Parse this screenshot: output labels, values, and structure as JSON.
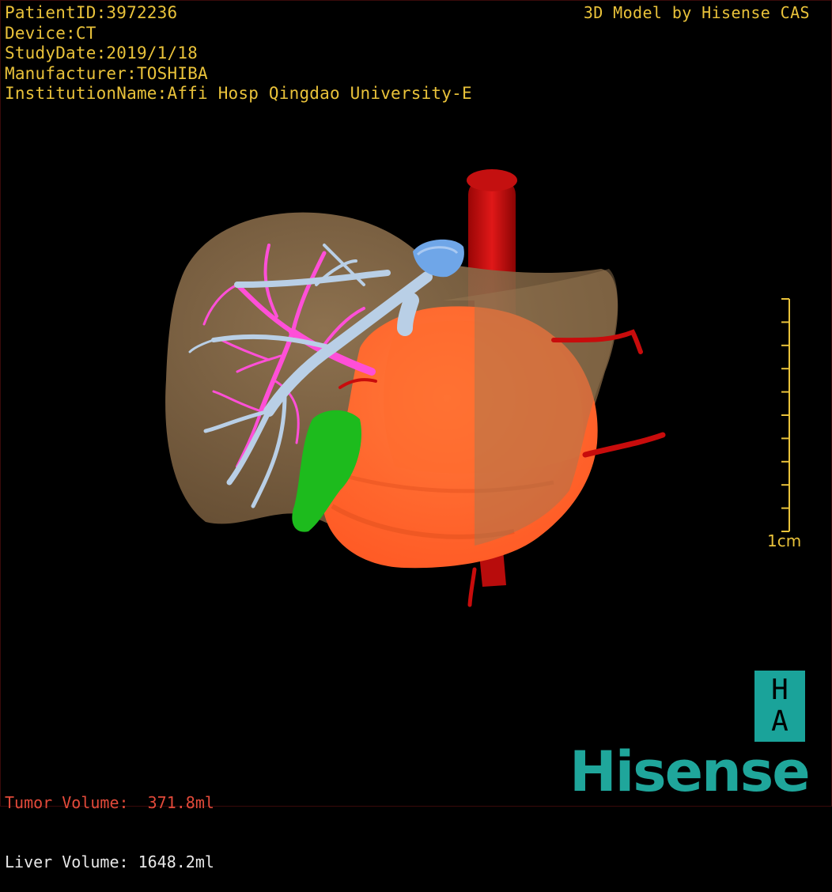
{
  "patient_info": {
    "patient_id": "PatientID:3972236",
    "device": "Device:CT",
    "study_date": "StudyDate:2019/1/18",
    "manufacturer": "Manufacturer:TOSHIBA",
    "institution": "InstitutionName:Affi Hosp Qingdao University-E"
  },
  "header": {
    "brand_text": "3D Model by Hisense CAS"
  },
  "scale_bar": {
    "label": "1cm",
    "tick_count": 11
  },
  "volumes": {
    "tumor": "Tumor Volume:  371.8ml",
    "liver": "Liver Volume: 1648.2ml"
  },
  "logo": {
    "badge_top": "H",
    "badge_bottom": "A",
    "brand": "Hisense"
  },
  "colors": {
    "text": "#e9c23a",
    "tumor_text": "#e24a3a",
    "liver": "#8a6a45",
    "tumor": "#ff6a2e",
    "portal_vein": "#ff5ad9",
    "hepatic_vein": "#b9cfe6",
    "ivc_cap": "#6fa6e8",
    "artery": "#c80c0c",
    "gallbladder": "#1dbb1d",
    "logo": "#1fa69b"
  }
}
